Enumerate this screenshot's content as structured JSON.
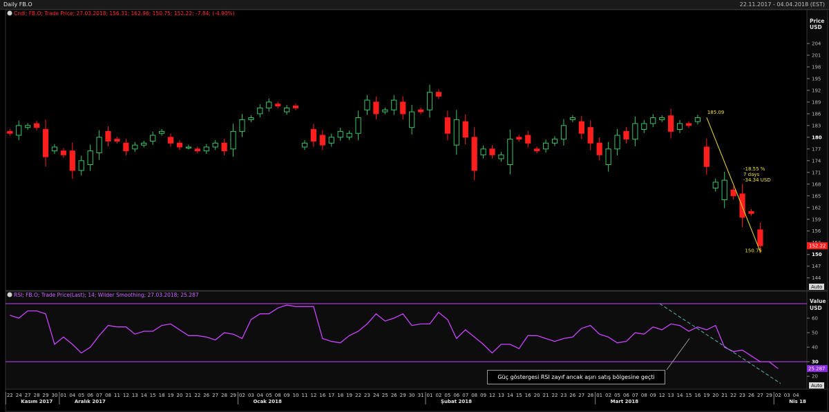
{
  "window": {
    "title": "Daily FB.O",
    "date_range": "22.11.2017 - 04.04.2018 (EST)"
  },
  "colors": {
    "up": "#35c86a",
    "down": "#ff1e1e",
    "rsi": "#cc44ff",
    "annotation": "#f0e030",
    "trend": "#5fb3b3",
    "price_tag": "#ff1e1e",
    "rsi_tag": "#8a2be2"
  },
  "chart_data": [
    {
      "type": "candlestick",
      "legend": "Cndl; FB.O; Trade Price; 27.03.2018; 156.31; 162.96; 150.75; 152.22; -7.84; (-4.90%)",
      "ylabel": "Price",
      "yunit": "USD",
      "ylim": [
        142,
        207
      ],
      "yticks": [
        144,
        147,
        150,
        153,
        156,
        159,
        162,
        165,
        168,
        171,
        174,
        177,
        180,
        183,
        186,
        189,
        192,
        195,
        198,
        201,
        204
      ],
      "bold_ticks": [
        150,
        180
      ],
      "grid": false,
      "scale_button": "Auto",
      "last_price_label": "152.22",
      "candles": [
        [
          "22",
          181.5,
          181.0
        ],
        [
          "24",
          180.5,
          183.0
        ],
        [
          "27",
          182.5,
          183.0
        ],
        [
          "28",
          183.5,
          182.5
        ],
        [
          "29",
          182.0,
          175.0
        ],
        [
          "30",
          176.5,
          177.5
        ],
        [
          "01",
          176.5,
          175.5
        ],
        [
          "04",
          176.5,
          171.5
        ],
        [
          "05",
          171.5,
          174.0
        ],
        [
          "06",
          173.0,
          176.5
        ],
        [
          "07",
          176.0,
          180.0
        ],
        [
          "08",
          181.5,
          179.0
        ],
        [
          "11",
          179.5,
          179.0
        ],
        [
          "12",
          178.5,
          176.5
        ],
        [
          "13",
          177.0,
          178.0
        ],
        [
          "14",
          178.0,
          178.5
        ],
        [
          "15",
          179.0,
          180.5
        ],
        [
          "18",
          181.0,
          181.5
        ],
        [
          "19",
          180.0,
          178.5
        ],
        [
          "20",
          178.5,
          177.5
        ],
        [
          "21",
          177.5,
          177.5
        ],
        [
          "22",
          177.0,
          176.5
        ],
        [
          "26",
          176.5,
          177.5
        ],
        [
          "27",
          177.5,
          178.5
        ],
        [
          "28",
          178.5,
          176.5
        ],
        [
          "29",
          177.0,
          181.5
        ],
        [
          "02",
          181.5,
          184.5
        ],
        [
          "03",
          184.5,
          185.0
        ],
        [
          "04",
          186.0,
          187.5
        ],
        [
          "05",
          187.5,
          189.0
        ],
        [
          "08",
          188.5,
          188.0
        ],
        [
          "09",
          186.5,
          187.5
        ],
        [
          "10",
          188.0,
          187.5
        ],
        [
          "11",
          177.5,
          178.5
        ],
        [
          "12",
          182.0,
          179.0
        ],
        [
          "16",
          180.5,
          178.0
        ],
        [
          "17",
          178.5,
          180.0
        ],
        [
          "18",
          180.0,
          181.5
        ],
        [
          "19",
          180.0,
          181.0
        ],
        [
          "22",
          181.0,
          185.0
        ],
        [
          "23",
          187.0,
          189.5
        ],
        [
          "24",
          189.0,
          186.0
        ],
        [
          "25",
          186.5,
          187.0
        ],
        [
          "26",
          187.0,
          189.5
        ],
        [
          "29",
          189.0,
          186.0
        ],
        [
          "30",
          182.5,
          186.5
        ],
        [
          "31",
          187.0,
          186.5
        ],
        [
          "01",
          187.0,
          191.5
        ],
        [
          "02",
          191.5,
          190.5
        ],
        [
          "05",
          185.0,
          181.0
        ],
        [
          "06",
          178.0,
          184.5
        ],
        [
          "07",
          184.0,
          180.0
        ],
        [
          "08",
          180.0,
          171.5
        ],
        [
          "09",
          175.5,
          177.0
        ],
        [
          "12",
          177.0,
          175.5
        ],
        [
          "13",
          174.5,
          175.5
        ],
        [
          "14",
          173.0,
          179.5
        ],
        [
          "15",
          180.0,
          179.5
        ],
        [
          "16",
          180.5,
          178.5
        ],
        [
          "20",
          177.0,
          176.5
        ],
        [
          "21",
          177.0,
          178.5
        ],
        [
          "22",
          178.5,
          179.5
        ],
        [
          "23",
          179.5,
          183.0
        ],
        [
          "26",
          184.5,
          185.0
        ],
        [
          "27",
          184.0,
          181.0
        ],
        [
          "28",
          182.5,
          178.5
        ],
        [
          "01",
          178.5,
          175.5
        ],
        [
          "02",
          173.0,
          177.0
        ],
        [
          "05",
          177.0,
          180.5
        ],
        [
          "06",
          181.5,
          179.5
        ],
        [
          "07",
          179.5,
          183.5
        ],
        [
          "08",
          182.0,
          183.5
        ],
        [
          "09",
          183.5,
          185.0
        ],
        [
          "12",
          184.5,
          185.0
        ],
        [
          "13",
          185.5,
          181.5
        ],
        [
          "14",
          182.0,
          183.5
        ],
        [
          "15",
          183.5,
          183.0
        ],
        [
          "16",
          184.0,
          185.0
        ],
        [
          "19",
          177.5,
          172.5
        ],
        [
          "20",
          167.0,
          168.5
        ],
        [
          "21",
          164.0,
          169.0
        ],
        [
          "22",
          166.5,
          165.0
        ],
        [
          "23",
          165.5,
          159.5
        ],
        [
          "26",
          161.0,
          160.5
        ],
        [
          "27",
          156.31,
          152.22
        ]
      ],
      "annotations": {
        "high_label": "185.09",
        "low_label": "150.75",
        "change_lines": [
          "-18.55 %",
          "7 days",
          "-34.34 USD"
        ]
      }
    },
    {
      "type": "line",
      "legend": "RSI; FB.O; Trade Price(Last);  14; Wilder Smoothing; 27.03.2018; 25.287",
      "ylabel": "Value",
      "yunit": "USD",
      "ylim": [
        12,
        70
      ],
      "yticks": [
        20,
        30,
        40,
        50,
        60
      ],
      "bold_ticks": [
        30
      ],
      "levels": [
        30,
        70
      ],
      "scale_button": "Auto",
      "last_value_label": "25.287",
      "values": [
        62,
        60,
        65,
        65,
        63,
        42,
        47,
        42,
        36,
        40,
        48,
        55,
        54,
        54,
        49,
        51,
        51,
        55,
        56,
        52,
        48,
        48,
        47,
        45,
        50,
        49,
        46,
        59,
        63,
        63,
        67,
        69,
        68,
        68,
        68,
        46,
        44,
        43,
        48,
        51,
        56,
        63,
        58,
        60,
        63,
        55,
        56,
        56,
        64,
        59,
        46,
        52,
        47,
        42,
        36,
        42,
        42,
        39,
        48,
        48,
        46,
        44,
        46,
        47,
        53,
        55,
        49,
        47,
        43,
        44,
        50,
        49,
        54,
        52,
        56,
        55,
        51,
        54,
        52,
        55,
        40,
        37,
        38,
        34,
        30,
        30,
        25.287
      ],
      "callout": "Güç göstergesi RSI zayıf ancak aşırı satış bölgesine geçti"
    }
  ],
  "x_axis": {
    "labels": [
      "22",
      "24",
      "27",
      "28",
      "29",
      "30",
      "01",
      "04",
      "05",
      "06",
      "07",
      "08",
      "11",
      "12",
      "13",
      "14",
      "15",
      "18",
      "19",
      "20",
      "21",
      "22",
      "26",
      "27",
      "28",
      "29",
      "02",
      "03",
      "04",
      "05",
      "08",
      "09",
      "10",
      "11",
      "12",
      "16",
      "17",
      "18",
      "19",
      "22",
      "23",
      "24",
      "25",
      "26",
      "29",
      "30",
      "31",
      "01",
      "02",
      "05",
      "06",
      "07",
      "08",
      "09",
      "12",
      "13",
      "14",
      "15",
      "16",
      "20",
      "21",
      "22",
      "23",
      "26",
      "27",
      "28",
      "01",
      "02",
      "05",
      "06",
      "07",
      "08",
      "09",
      "12",
      "13",
      "14",
      "15",
      "16",
      "19",
      "20",
      "21",
      "22",
      "23",
      "26",
      "27",
      "29",
      "02",
      "03",
      "04"
    ],
    "months": [
      {
        "label": "Kasım 2017",
        "index": 0
      },
      {
        "label": "Aralık 2017",
        "index": 6
      },
      {
        "label": "Ocak 2018",
        "index": 26
      },
      {
        "label": "Şubat 2018",
        "index": 47
      },
      {
        "label": "Mart 2018",
        "index": 66
      },
      {
        "label": "Nis 18",
        "index": 86
      }
    ]
  }
}
